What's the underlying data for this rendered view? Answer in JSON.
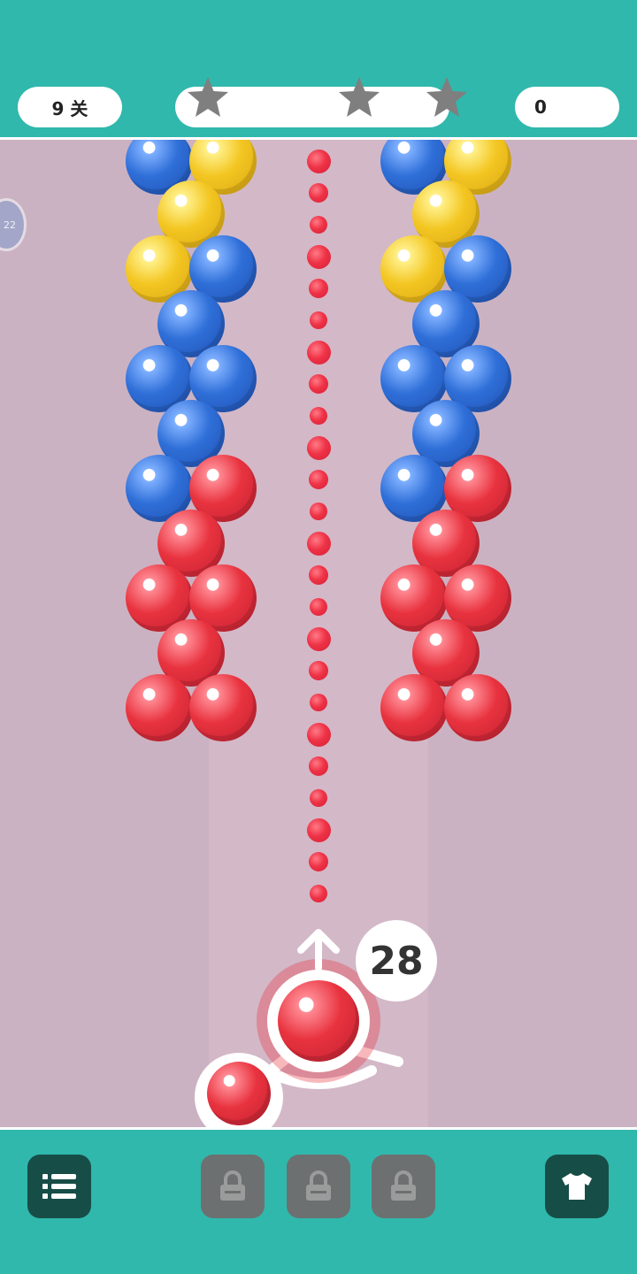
{
  "header": {
    "level_label": "9 关",
    "score": "0",
    "stars": {
      "count": 3,
      "color": "#7f7f7f"
    },
    "progress": 0
  },
  "side_badge": {
    "text": "22",
    "icon": "clock-badge-icon"
  },
  "colors": {
    "red": "#e8333f",
    "blue": "#2f6fd8",
    "yellow": "#f3c622",
    "teal": "#30b8ac",
    "dark_button": "#174d47",
    "grey_button": "#6d7070"
  },
  "board": {
    "column_color_sequence_top_to_bottom": [
      "blue",
      "yellow",
      "yellow",
      "yellow",
      "blue",
      "blue",
      "blue",
      "blue",
      "blue",
      "blue",
      "red",
      "red",
      "red",
      "red",
      "red",
      "red",
      "red"
    ],
    "columns": 2
  },
  "aim_line": {
    "color": "red",
    "dots": 24
  },
  "shooter": {
    "current_ball": "red",
    "next_ball": "red",
    "remaining_shots": "28",
    "arrow_icon": "up-arrow-icon"
  },
  "footer": {
    "menu_icon": "list-icon",
    "locked_slots": [
      {
        "icon": "lock-icon"
      },
      {
        "icon": "lock-icon"
      },
      {
        "icon": "lock-icon"
      }
    ],
    "skin_icon": "tshirt-icon"
  }
}
